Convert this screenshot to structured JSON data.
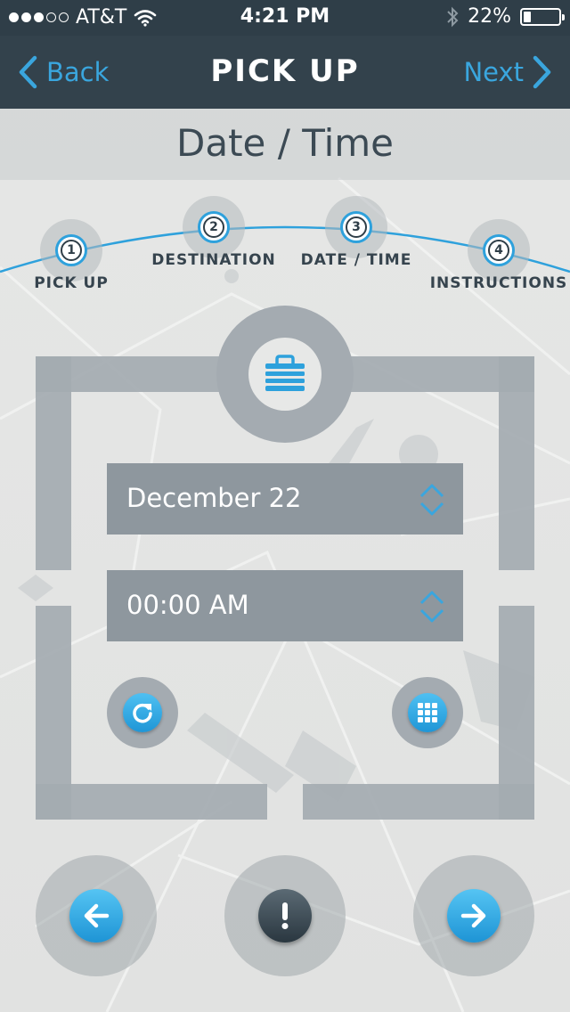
{
  "status_bar": {
    "carrier": "AT&T",
    "signal_bars_filled": 3,
    "signal_bars_total": 5,
    "time": "4:21 PM",
    "battery_percent": "22%",
    "battery_level": 0.22
  },
  "nav": {
    "back_label": "Back",
    "title": "PICK UP",
    "next_label": "Next"
  },
  "page_title": "Date / Time",
  "steps": [
    {
      "number": "1",
      "label": "PICK UP"
    },
    {
      "number": "2",
      "label": "DESTINATION"
    },
    {
      "number": "3",
      "label": "DATE / TIME"
    },
    {
      "number": "4",
      "label": "INSTRUCTIONS"
    }
  ],
  "form": {
    "date_value": "December 22",
    "time_value": "00:00 AM"
  },
  "icons": {
    "center": "briefcase-icon",
    "refresh": "refresh-icon",
    "calendar": "calendar-grid-icon",
    "prev": "arrow-left-icon",
    "info": "exclamation-icon",
    "next": "arrow-right-icon"
  },
  "colors": {
    "accent": "#2ea1dc",
    "bar": "#33424c",
    "picker": "#8e979e",
    "frame": "#a4abb1",
    "text_dark": "#36444e"
  }
}
